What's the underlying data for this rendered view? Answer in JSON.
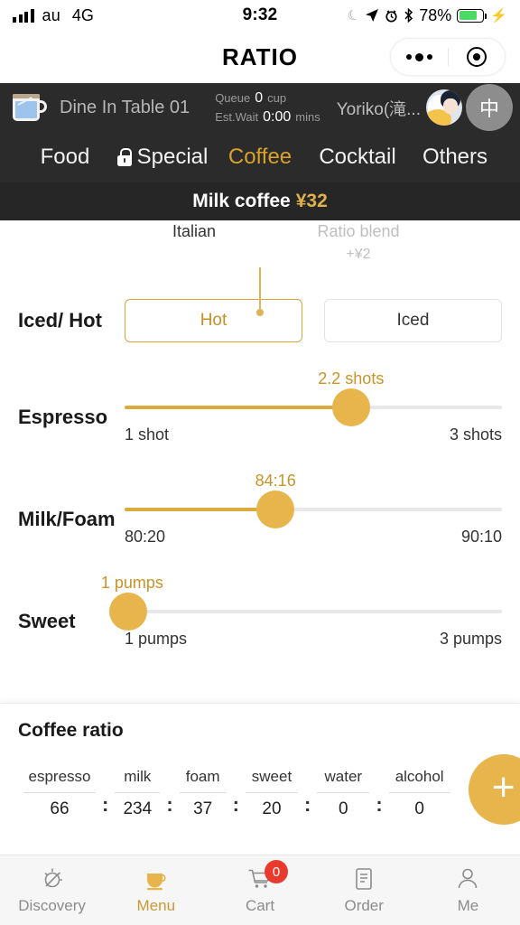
{
  "status_bar": {
    "carrier": "au",
    "network": "4G",
    "time": "9:32",
    "battery_percent": "78%",
    "icons": [
      "signal-icon",
      "moon-icon",
      "location-arrow-icon",
      "alarm-icon",
      "bluetooth-icon",
      "battery-icon",
      "charging-bolt-icon"
    ]
  },
  "titlebar": {
    "title": "RATIO",
    "capsule": {
      "more_icon": "more-dots-icon",
      "target_icon": "target-icon"
    }
  },
  "header": {
    "table_label": "Dine In Table  01",
    "queue_key": "Queue",
    "queue_value": "0",
    "queue_unit": "cup",
    "wait_key": "Est.Wait",
    "wait_value": "0:00",
    "wait_unit": "mins",
    "user_name": "Yoriko(滝...",
    "lang_button": "中"
  },
  "tabs": [
    {
      "label": "Food",
      "active": false,
      "locked": false
    },
    {
      "label": "Special",
      "active": false,
      "locked": true
    },
    {
      "label": "Coffee",
      "active": true,
      "locked": false
    },
    {
      "label": "Cocktail",
      "active": false,
      "locked": false
    },
    {
      "label": "Others",
      "active": false,
      "locked": false
    }
  ],
  "item_bar": {
    "name": "Milk coffee",
    "price": "¥32"
  },
  "blends": [
    {
      "name": "Italian",
      "price": "",
      "selected": true
    },
    {
      "name": "Ratio blend",
      "price": "+¥2",
      "selected": false
    }
  ],
  "options": {
    "iced_hot": {
      "label": "Iced/ Hot",
      "choices": [
        {
          "label": "Hot",
          "selected": true
        },
        {
          "label": "Iced",
          "selected": false
        }
      ]
    },
    "sliders": [
      {
        "label": "Espresso",
        "value_text": "2.2 shots",
        "min_label": "1 shot",
        "max_label": "3 shots",
        "percent": 60
      },
      {
        "label": "Milk/Foam",
        "value_text": "84:16",
        "min_label": "80:20",
        "max_label": "90:10",
        "percent": 40
      },
      {
        "label": "Sweet",
        "value_text": "1 pumps",
        "min_label": "1 pumps",
        "max_label": "3 pumps",
        "percent": 0
      }
    ]
  },
  "coffee_ratio": {
    "title": "Coffee ratio",
    "separator": ":",
    "items": [
      {
        "label": "espresso",
        "value": "66"
      },
      {
        "label": "milk",
        "value": "234"
      },
      {
        "label": "foam",
        "value": "37"
      },
      {
        "label": "sweet",
        "value": "20"
      },
      {
        "label": "water",
        "value": "0"
      },
      {
        "label": "alcohol",
        "value": "0"
      }
    ],
    "add_button": "+"
  },
  "bottom_nav": [
    {
      "label": "Discovery",
      "icon": "discovery-icon",
      "active": false,
      "badge": ""
    },
    {
      "label": "Menu",
      "icon": "cup-icon",
      "active": true,
      "badge": ""
    },
    {
      "label": "Cart",
      "icon": "cart-icon",
      "active": false,
      "badge": "0"
    },
    {
      "label": "Order",
      "icon": "document-icon",
      "active": false,
      "badge": ""
    },
    {
      "label": "Me",
      "icon": "person-icon",
      "active": false,
      "badge": ""
    }
  ],
  "colors": {
    "accent_gold": "#e7b54b",
    "accent_gold_text": "#c99327",
    "header_dark": "#2b2b2b",
    "item_bar_dark": "#262626",
    "badge_red": "#e93b2d",
    "battery_green": "#4cd964"
  }
}
